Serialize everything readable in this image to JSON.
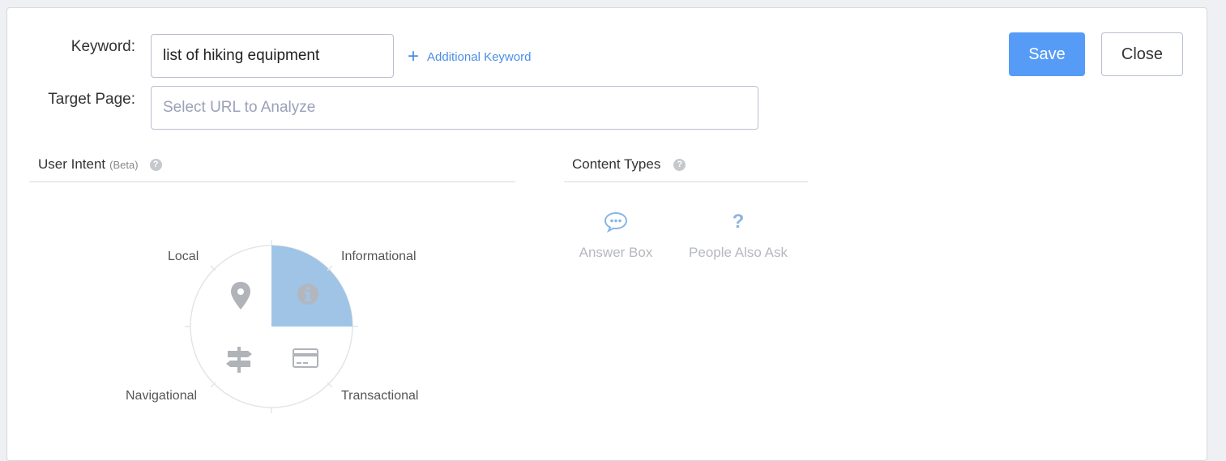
{
  "form": {
    "keyword_label": "Keyword:",
    "keyword_value": "list of hiking equipment",
    "additional_keyword_label": "Additional Keyword",
    "target_page_label": "Target Page:",
    "target_page_placeholder": "Select URL to Analyze",
    "target_page_value": ""
  },
  "actions": {
    "save_label": "Save",
    "close_label": "Close"
  },
  "user_intent": {
    "title": "User Intent",
    "beta": "(Beta)",
    "help_icon": "question-circle-icon",
    "quadrants": {
      "local": {
        "label": "Local",
        "icon": "map-pin-icon",
        "active": false
      },
      "informational": {
        "label": "Informational",
        "icon": "info-circle-icon",
        "active": true
      },
      "navigational": {
        "label": "Navigational",
        "icon": "signpost-icon",
        "active": false
      },
      "transactional": {
        "label": "Transactional",
        "icon": "credit-card-icon",
        "active": false
      }
    }
  },
  "content_types": {
    "title": "Content Types",
    "help_icon": "question-circle-icon",
    "items": [
      {
        "label": "Answer Box",
        "icon": "speech-bubble-icon"
      },
      {
        "label": "People Also Ask",
        "icon": "question-mark-icon"
      }
    ]
  },
  "colors": {
    "primary": "#569cf7",
    "link": "#4a8fe7",
    "active_quadrant": "#9fc4e6",
    "muted_text": "#b5b8bd"
  }
}
